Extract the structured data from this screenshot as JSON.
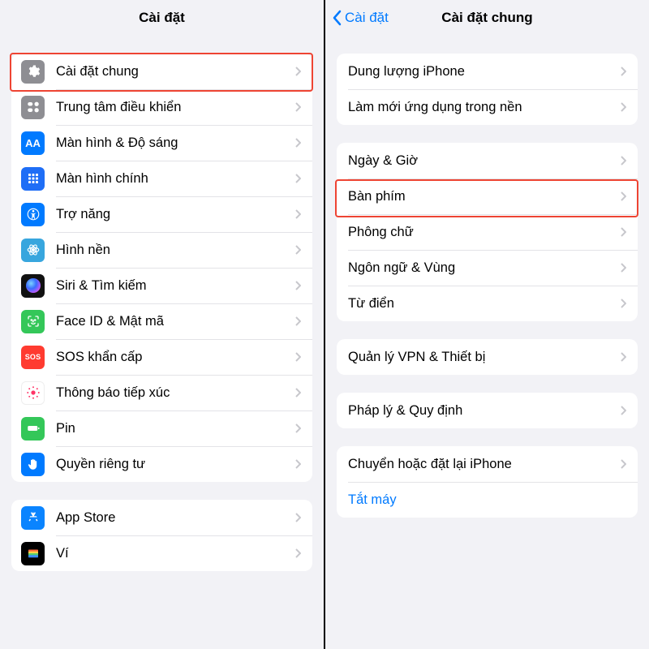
{
  "left": {
    "title": "Cài đặt",
    "group1": [
      {
        "label": "Cài đặt chung",
        "icon": "gear-icon"
      },
      {
        "label": "Trung tâm điều khiển",
        "icon": "control-center-icon"
      },
      {
        "label": "Màn hình & Độ sáng",
        "icon": "display-brightness-icon"
      },
      {
        "label": "Màn hình chính",
        "icon": "home-screen-icon"
      },
      {
        "label": "Trợ năng",
        "icon": "accessibility-icon"
      },
      {
        "label": "Hình nền",
        "icon": "wallpaper-icon"
      },
      {
        "label": "Siri & Tìm kiếm",
        "icon": "siri-icon"
      },
      {
        "label": "Face ID & Mật mã",
        "icon": "faceid-icon"
      },
      {
        "label": "SOS khẩn cấp",
        "icon": "sos-icon"
      },
      {
        "label": "Thông báo tiếp xúc",
        "icon": "exposure-icon"
      },
      {
        "label": "Pin",
        "icon": "battery-icon"
      },
      {
        "label": "Quyền riêng tư",
        "icon": "privacy-hand-icon"
      }
    ],
    "group2": [
      {
        "label": "App Store",
        "icon": "appstore-icon"
      },
      {
        "label": "Ví",
        "icon": "wallet-icon"
      }
    ]
  },
  "right": {
    "back": "Cài đặt",
    "title": "Cài đặt chung",
    "groupA": [
      {
        "label": "Dung lượng iPhone"
      },
      {
        "label": "Làm mới ứng dụng trong nền"
      }
    ],
    "groupB": [
      {
        "label": "Ngày & Giờ"
      },
      {
        "label": "Bàn phím"
      },
      {
        "label": "Phông chữ"
      },
      {
        "label": "Ngôn ngữ & Vùng"
      },
      {
        "label": "Từ điển"
      }
    ],
    "groupC": [
      {
        "label": "Quản lý VPN & Thiết bị"
      }
    ],
    "groupD": [
      {
        "label": "Pháp lý & Quy định"
      }
    ],
    "groupE": [
      {
        "label": "Chuyển hoặc đặt lại iPhone"
      },
      {
        "label": "Tắt máy",
        "class": "blue-text"
      }
    ]
  }
}
